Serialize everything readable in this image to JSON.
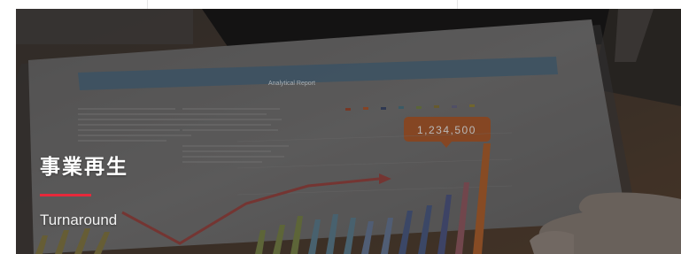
{
  "card": {
    "title": "事業再生",
    "subtitle": "Turnaround",
    "accent_color": "#e6293b"
  },
  "photo": {
    "report_header": "Analytical Report",
    "callout_value": "1,234,500"
  }
}
